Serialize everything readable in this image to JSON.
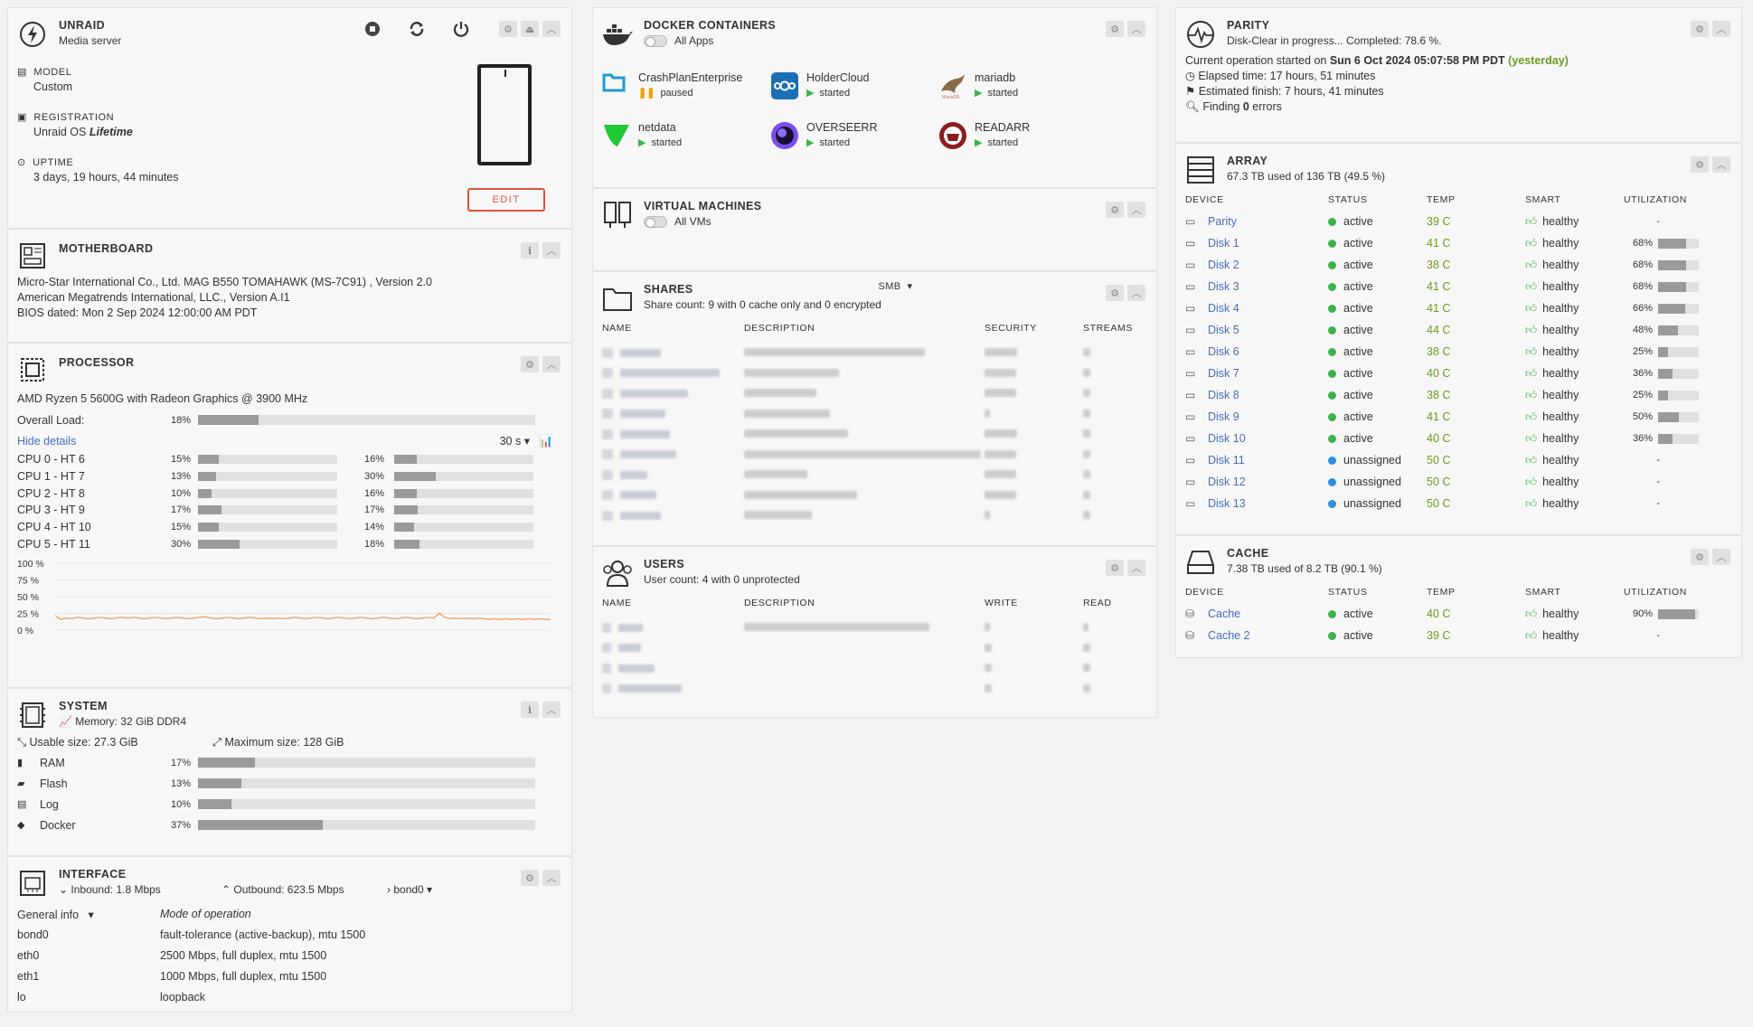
{
  "unraid": {
    "title": "UNRAID",
    "subtitle": "Media server",
    "model_label": "MODEL",
    "model_value": "Custom",
    "registration_label": "REGISTRATION",
    "registration_prefix": "Unraid OS",
    "registration_value": "Lifetime",
    "uptime_label": "UPTIME",
    "uptime_value": "3 days, 19 hours, 44 minutes",
    "edit_label": "EDIT"
  },
  "motherboard": {
    "title": "MOTHERBOARD",
    "line1": "Micro-Star International Co., Ltd. MAG B550 TOMAHAWK (MS-7C91) , Version 2.0",
    "line2": "American Megatrends International, LLC., Version A.I1",
    "line3": "BIOS dated: Mon 2 Sep 2024 12:00:00 AM PDT"
  },
  "processor": {
    "title": "PROCESSOR",
    "model": "AMD Ryzen 5 5600G with Radeon Graphics @ 3900 MHz",
    "overall_label": "Overall Load:",
    "overall_pct": 18,
    "overall_text": "18%",
    "hide_details": "Hide details",
    "interval": "30 s",
    "cpus": [
      {
        "label": "CPU 0 - HT 6",
        "a": 15,
        "a_text": "15%",
        "b": 16,
        "b_text": "16%"
      },
      {
        "label": "CPU 1 - HT 7",
        "a": 13,
        "a_text": "13%",
        "b": 30,
        "b_text": "30%"
      },
      {
        "label": "CPU 2 - HT 8",
        "a": 10,
        "a_text": "10%",
        "b": 16,
        "b_text": "16%"
      },
      {
        "label": "CPU 3 - HT 9",
        "a": 17,
        "a_text": "17%",
        "b": 17,
        "b_text": "17%"
      },
      {
        "label": "CPU 4 - HT 10",
        "a": 15,
        "a_text": "15%",
        "b": 14,
        "b_text": "14%"
      },
      {
        "label": "CPU 5 - HT 11",
        "a": 30,
        "a_text": "30%",
        "b": 18,
        "b_text": "18%"
      }
    ],
    "graph_ticks": [
      "100 %",
      "75 %",
      "50 %",
      "25 %",
      "0 %"
    ],
    "graph_values": [
      22,
      16,
      18,
      17,
      19,
      18,
      17,
      18,
      19,
      18,
      17,
      18,
      19,
      18,
      19,
      18,
      17,
      18,
      19,
      18,
      17,
      18,
      19,
      18,
      17,
      18,
      19,
      20,
      18,
      17,
      18,
      19,
      18,
      17,
      18,
      19,
      18,
      17,
      18,
      17,
      18,
      17,
      18,
      19,
      18,
      17,
      18,
      19,
      18,
      17,
      18,
      19,
      18,
      17,
      18,
      19,
      18,
      17,
      18,
      19,
      18,
      17,
      18,
      19,
      18,
      17,
      18,
      19,
      18,
      25,
      19,
      17,
      18,
      17,
      18,
      17,
      18,
      17,
      16,
      17,
      16,
      17,
      16,
      17,
      16,
      17,
      16,
      17,
      16,
      16
    ]
  },
  "system": {
    "title": "SYSTEM",
    "memory": "Memory: 32 GiB DDR4",
    "usable": "Usable size: 27.3 GiB",
    "maximum": "Maximum size: 128 GiB",
    "items": [
      {
        "label": "RAM",
        "pct": 17,
        "text": "17%"
      },
      {
        "label": "Flash",
        "pct": 13,
        "text": "13%"
      },
      {
        "label": "Log",
        "pct": 10,
        "text": "10%"
      },
      {
        "label": "Docker",
        "pct": 37,
        "text": "37%"
      }
    ]
  },
  "interface": {
    "title": "INTERFACE",
    "inbound": "Inbound: 1.8 Mbps",
    "outbound": "Outbound: 623.5 Mbps",
    "iface": "bond0",
    "general_info": "General info",
    "mode_header": "Mode of operation",
    "rows": [
      {
        "name": "bond0",
        "value": "fault-tolerance (active-backup), mtu 1500"
      },
      {
        "name": "eth0",
        "value": "2500 Mbps, full duplex, mtu 1500"
      },
      {
        "name": "eth1",
        "value": "1000 Mbps, full duplex, mtu 1500"
      },
      {
        "name": "lo",
        "value": "loopback"
      }
    ]
  },
  "docker": {
    "title": "DOCKER CONTAINERS",
    "toggle_label": "All Apps",
    "containers": [
      {
        "name": "CrashPlanEnterprise",
        "status": "paused"
      },
      {
        "name": "HolderCloud",
        "status": "started"
      },
      {
        "name": "mariadb",
        "status": "started"
      },
      {
        "name": "netdata",
        "status": "started"
      },
      {
        "name": "OVERSEERR",
        "status": "started"
      },
      {
        "name": "READARR",
        "status": "started"
      }
    ]
  },
  "vms": {
    "title": "VIRTUAL MACHINES",
    "toggle_label": "All VMs"
  },
  "shares": {
    "title": "SHARES",
    "protocol": "SMB",
    "subtitle": "Share count: 9 with 0 cache only and 0 encrypted",
    "headers": [
      "NAME",
      "DESCRIPTION",
      "SECURITY",
      "STREAMS"
    ]
  },
  "users": {
    "title": "USERS",
    "subtitle": "User count: 4 with 0 unprotected",
    "headers": [
      "NAME",
      "DESCRIPTION",
      "WRITE",
      "READ"
    ]
  },
  "parity": {
    "title": "PARITY",
    "status": "Disk-Clear in progress... Completed: 78.6 %.",
    "op_prefix": "Current operation started on",
    "op_date": "Sun 6 Oct 2024 05:07:58 PM PDT",
    "op_rel": "(yesterday)",
    "elapsed": "Elapsed time: 17 hours, 51 minutes",
    "estimated": "Estimated finish: 7 hours, 41 minutes",
    "finding_prefix": "Finding",
    "finding_count": "0",
    "finding_suffix": "errors"
  },
  "array": {
    "title": "ARRAY",
    "subtitle": "67.3 TB used of 136 TB (49.5 %)",
    "headers": [
      "DEVICE",
      "STATUS",
      "TEMP",
      "SMART",
      "UTILIZATION"
    ],
    "devices": [
      {
        "name": "Parity",
        "status": "active",
        "dot": "g",
        "temp": "39 C",
        "smart": "healthy",
        "util": null,
        "util_text": "-"
      },
      {
        "name": "Disk 1",
        "status": "active",
        "dot": "g",
        "temp": "41 C",
        "smart": "healthy",
        "util": 68,
        "util_text": "68%"
      },
      {
        "name": "Disk 2",
        "status": "active",
        "dot": "g",
        "temp": "38 C",
        "smart": "healthy",
        "util": 68,
        "util_text": "68%"
      },
      {
        "name": "Disk 3",
        "status": "active",
        "dot": "g",
        "temp": "41 C",
        "smart": "healthy",
        "util": 68,
        "util_text": "68%"
      },
      {
        "name": "Disk 4",
        "status": "active",
        "dot": "g",
        "temp": "41 C",
        "smart": "healthy",
        "util": 66,
        "util_text": "66%"
      },
      {
        "name": "Disk 5",
        "status": "active",
        "dot": "g",
        "temp": "44 C",
        "smart": "healthy",
        "util": 48,
        "util_text": "48%"
      },
      {
        "name": "Disk 6",
        "status": "active",
        "dot": "g",
        "temp": "38 C",
        "smart": "healthy",
        "util": 25,
        "util_text": "25%"
      },
      {
        "name": "Disk 7",
        "status": "active",
        "dot": "g",
        "temp": "40 C",
        "smart": "healthy",
        "util": 36,
        "util_text": "36%"
      },
      {
        "name": "Disk 8",
        "status": "active",
        "dot": "g",
        "temp": "38 C",
        "smart": "healthy",
        "util": 25,
        "util_text": "25%"
      },
      {
        "name": "Disk 9",
        "status": "active",
        "dot": "g",
        "temp": "41 C",
        "smart": "healthy",
        "util": 50,
        "util_text": "50%"
      },
      {
        "name": "Disk 10",
        "status": "active",
        "dot": "g",
        "temp": "40 C",
        "smart": "healthy",
        "util": 36,
        "util_text": "36%"
      },
      {
        "name": "Disk 11",
        "status": "unassigned",
        "dot": "b",
        "temp": "50 C",
        "smart": "healthy",
        "util": null,
        "util_text": "-"
      },
      {
        "name": "Disk 12",
        "status": "unassigned",
        "dot": "b",
        "temp": "50 C",
        "smart": "healthy",
        "util": null,
        "util_text": "-"
      },
      {
        "name": "Disk 13",
        "status": "unassigned",
        "dot": "b",
        "temp": "50 C",
        "smart": "healthy",
        "util": null,
        "util_text": "-"
      }
    ]
  },
  "cache": {
    "title": "CACHE",
    "subtitle": "7.38 TB used of 8.2 TB (90.1 %)",
    "headers": [
      "DEVICE",
      "STATUS",
      "TEMP",
      "SMART",
      "UTILIZATION"
    ],
    "devices": [
      {
        "name": "Cache",
        "status": "active",
        "dot": "g",
        "temp": "40 C",
        "smart": "healthy",
        "util": 90,
        "util_text": "90%"
      },
      {
        "name": "Cache 2",
        "status": "active",
        "dot": "g",
        "temp": "39 C",
        "smart": "healthy",
        "util": null,
        "util_text": "-"
      }
    ]
  },
  "colors": {
    "link": "#486dba",
    "temp_green": "#6a9c1a",
    "status_orange": "#e8840e",
    "active_dot": "#3cb34a",
    "unassigned_dot": "#2c8fe0",
    "bar_fill": "#9a9a9a",
    "graph_line": "#f0a060",
    "edit_border": "#e5523a"
  }
}
